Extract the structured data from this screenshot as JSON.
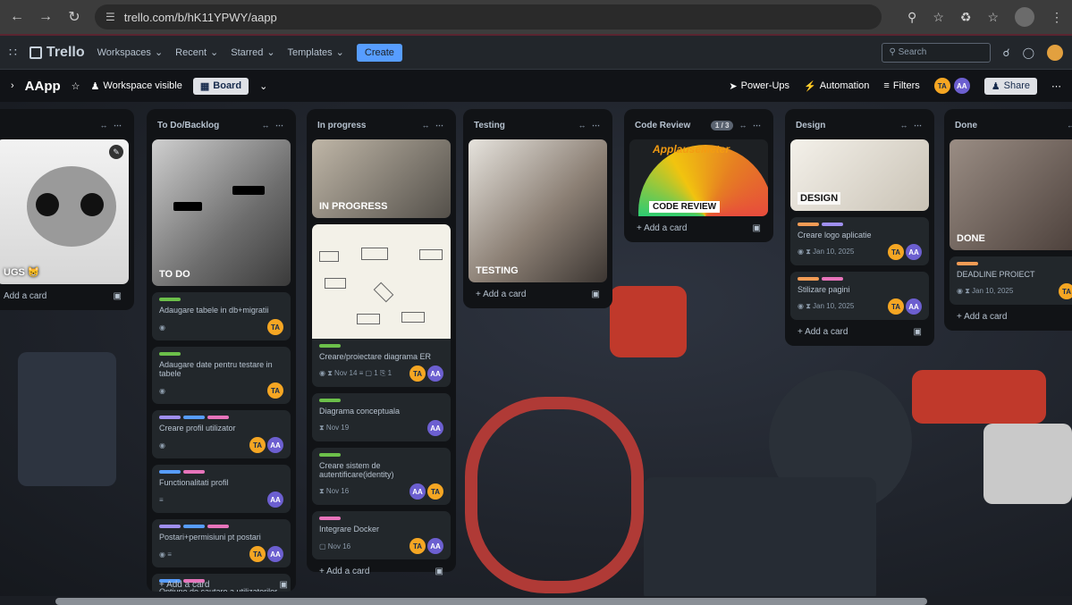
{
  "browser": {
    "url": "trello.com/b/hK11YPWY/aapp"
  },
  "topbar": {
    "app_name": "Trello",
    "menus": [
      "Workspaces",
      "Recent",
      "Starred",
      "Templates"
    ],
    "create_label": "Create",
    "search_placeholder": "Search"
  },
  "board": {
    "name": "AApp",
    "visibility": "Workspace visible",
    "view": "Board",
    "powerups": "Power-Ups",
    "automation": "Automation",
    "filters": "Filters",
    "share": "Share",
    "members": [
      "TA",
      "AA"
    ]
  },
  "add_card_label": "Add a card",
  "lists": [
    {
      "title": "",
      "cover_title": "UGS 😸",
      "cards": []
    },
    {
      "title": "To Do/Backlog",
      "cover_title": "TO DO",
      "cards": [
        {
          "title": "Adaugare tabele in db+migratii",
          "labels": [
            "#6cc04a"
          ],
          "meta": "◉",
          "members": [
            "TA"
          ]
        },
        {
          "title": "Adaugare date pentru testare in tabele",
          "labels": [
            "#6cc04a"
          ],
          "meta": "◉",
          "members": [
            "TA"
          ]
        },
        {
          "title": "Creare profil utilizator",
          "labels": [
            "#9f8fef",
            "#579dff",
            "#e774bb"
          ],
          "meta": "◉",
          "members": [
            "TA",
            "AA"
          ]
        },
        {
          "title": "Functionalitati profil",
          "labels": [
            "#579dff",
            "#e774bb"
          ],
          "meta": "≡",
          "members": [
            "AA"
          ]
        },
        {
          "title": "Postari+permisiuni pt postari",
          "labels": [
            "#9f8fef",
            "#579dff",
            "#e774bb"
          ],
          "meta": "◉ ≡",
          "members": [
            "TA",
            "AA"
          ]
        },
        {
          "title": "Optiune de cautare a utilizatorilor",
          "labels": [
            "#579dff",
            "#e774bb"
          ],
          "meta": "",
          "members": [
            "AA"
          ]
        }
      ]
    },
    {
      "title": "In progress",
      "cover_title": "IN PROGRESS",
      "cards": [
        {
          "title": "Creare/proiectare diagrama ER",
          "labels": [
            "#6cc04a"
          ],
          "meta": "◉  ⧗ Nov 14  ≡  ▢ 1  ⎘ 1",
          "members": [
            "TA",
            "AA"
          ]
        },
        {
          "title": "Diagrama conceptuala",
          "labels": [
            "#6cc04a"
          ],
          "meta": "⧗ Nov 19",
          "members": [
            "AA"
          ]
        },
        {
          "title": "Creare sistem de autentificare(identity)",
          "labels": [
            "#6cc04a"
          ],
          "meta": "⧗ Nov 16",
          "members": [
            "AA",
            "TA"
          ]
        },
        {
          "title": "Integrare Docker",
          "labels": [
            "#e774bb"
          ],
          "meta": "▢ Nov 16",
          "members": [
            "TA",
            "AA"
          ]
        }
      ]
    },
    {
      "title": "Testing",
      "cover_title": "TESTING",
      "cards": []
    },
    {
      "title": "Code Review",
      "count": "1 / 3",
      "cover_title": "CODE REVIEW",
      "cards": []
    },
    {
      "title": "Design",
      "cover_title": "DESIGN",
      "cards": [
        {
          "title": "Creare logo aplicatie",
          "labels": [
            "#f39c55",
            "#9f8fef"
          ],
          "meta": "◉  ⧗ Jan 10, 2025",
          "members": [
            "TA",
            "AA"
          ]
        },
        {
          "title": "Stilizare pagini",
          "labels": [
            "#f39c55",
            "#e774bb"
          ],
          "meta": "◉  ⧗ Jan 10, 2025",
          "members": [
            "TA",
            "AA"
          ]
        }
      ]
    },
    {
      "title": "Done",
      "cover_title": "DONE",
      "cards": [
        {
          "title": "DEADLINE PROIECT",
          "labels": [
            "#f39c55"
          ],
          "meta": "◉  ⧗ Jan 10, 2025",
          "members": [
            "TA"
          ]
        }
      ]
    }
  ],
  "code_review_cover_text": "ApplauseMeter"
}
